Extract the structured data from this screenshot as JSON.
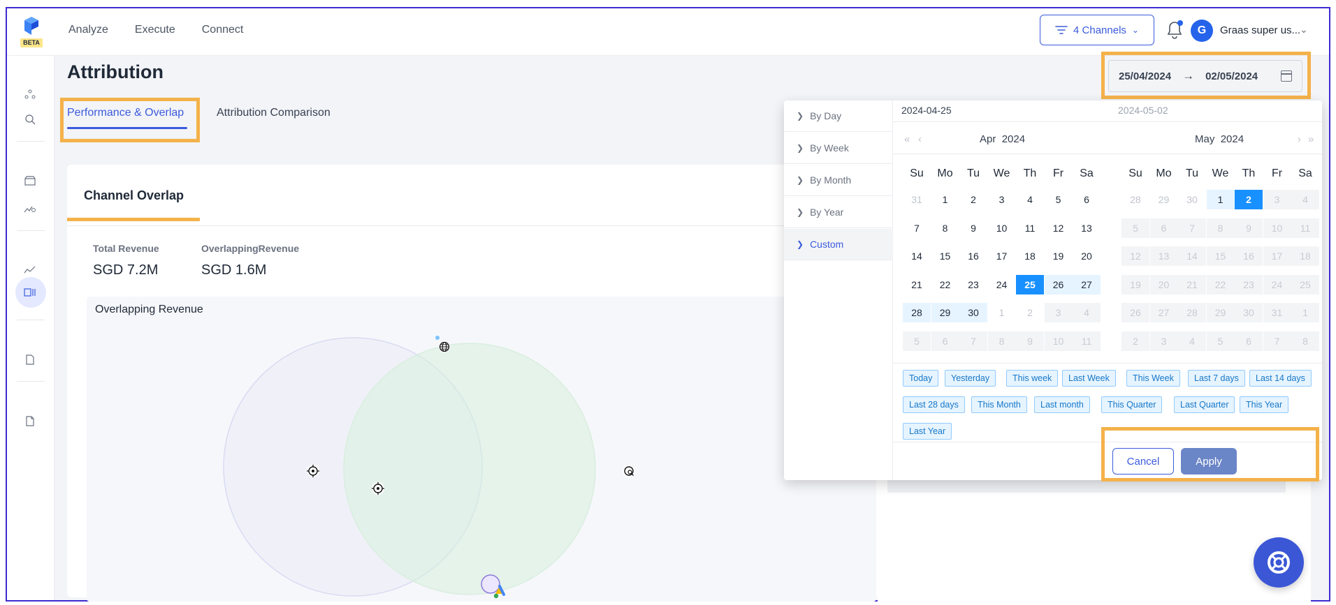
{
  "brand": {
    "badge": "BETA"
  },
  "nav": [
    "Analyze",
    "Execute",
    "Connect"
  ],
  "header": {
    "channels_label": "4 Channels",
    "avatar_initial": "G",
    "user_name": "Graas super us..."
  },
  "page": {
    "title": "Attribution"
  },
  "tabs": [
    {
      "label": "Performance & Overlap",
      "active": true
    },
    {
      "label": "Attribution Comparison",
      "active": false
    }
  ],
  "card": {
    "title": "Channel Overlap"
  },
  "metrics": [
    {
      "label": "Total Revenue",
      "value": "SGD 7.2M"
    },
    {
      "label": "OverlappingRevenue",
      "value": "SGD 1.6M"
    }
  ],
  "venn": {
    "title": "Overlapping Revenue"
  },
  "date_range": {
    "start": "25/04/2024",
    "arrow": "→",
    "end": "02/05/2024"
  },
  "picker": {
    "presets": [
      {
        "label": "By Day",
        "active": false
      },
      {
        "label": "By Week",
        "active": false
      },
      {
        "label": "By Month",
        "active": false
      },
      {
        "label": "By Year",
        "active": false
      },
      {
        "label": "Custom",
        "active": true
      }
    ],
    "range_start": "2024-04-25",
    "range_end": "2024-05-02",
    "weekdays": [
      "Su",
      "Mo",
      "Tu",
      "We",
      "Th",
      "Fr",
      "Sa"
    ],
    "left": {
      "month": "Apr",
      "year": "2024",
      "weeks": [
        [
          "31",
          "1",
          "2",
          "3",
          "4",
          "5",
          "6"
        ],
        [
          "7",
          "8",
          "9",
          "10",
          "11",
          "12",
          "13"
        ],
        [
          "14",
          "15",
          "16",
          "17",
          "18",
          "19",
          "20"
        ],
        [
          "21",
          "22",
          "23",
          "24",
          "25",
          "26",
          "27"
        ],
        [
          "28",
          "29",
          "30",
          "1",
          "2",
          "3",
          "4"
        ],
        [
          "5",
          "6",
          "7",
          "8",
          "9",
          "10",
          "11"
        ]
      ]
    },
    "right": {
      "month": "May",
      "year": "2024",
      "weeks": [
        [
          "28",
          "29",
          "30",
          "1",
          "2",
          "3",
          "4"
        ],
        [
          "5",
          "6",
          "7",
          "8",
          "9",
          "10",
          "11"
        ],
        [
          "12",
          "13",
          "14",
          "15",
          "16",
          "17",
          "18"
        ],
        [
          "19",
          "20",
          "21",
          "22",
          "23",
          "24",
          "25"
        ],
        [
          "26",
          "27",
          "28",
          "29",
          "30",
          "31",
          "1"
        ],
        [
          "2",
          "3",
          "4",
          "5",
          "6",
          "7",
          "8"
        ]
      ]
    },
    "quick_ranges": [
      "Today",
      "Yesterday",
      "This week",
      "Last Week",
      "This Week",
      "Last 7 days",
      "Last 14 days",
      "Last 28 days",
      "This Month",
      "Last month",
      "This Quarter",
      "Last Quarter",
      "This Year",
      "Last Year"
    ],
    "cancel_label": "Cancel",
    "apply_label": "Apply"
  },
  "colors": {
    "accent": "#3b5bdb",
    "selected": "#1890ff",
    "highlight": "#f4b24a"
  }
}
